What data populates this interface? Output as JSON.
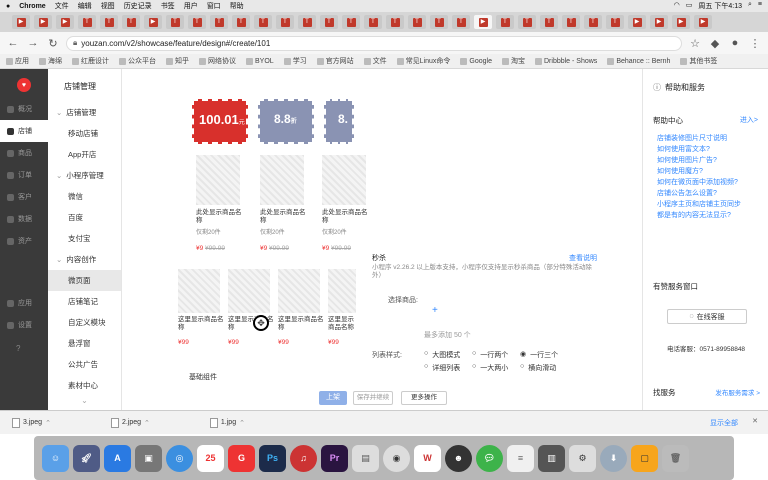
{
  "menubar": {
    "app": "Chrome",
    "items": [
      "文件",
      "编辑",
      "视图",
      "历史记录",
      "书签",
      "用户",
      "窗口",
      "帮助"
    ],
    "clock": "周五 下午4:13"
  },
  "browser": {
    "url": "youzan.com/v2/showcase/feature/design#/create/101",
    "bookmarks": [
      "应用",
      "海绵",
      "红鹿设计",
      "公众平台",
      "知乎",
      "网络协议",
      "BYOL",
      "学习",
      "官方网站",
      "文件",
      "常见Linux命令",
      "Google",
      "淘宝",
      "Dribbble - Shows",
      "Behance :: Bernh",
      "其他书签"
    ]
  },
  "leftnav": {
    "items": [
      "概况",
      "店铺",
      "商品",
      "订单",
      "客户",
      "数据",
      "资产",
      "应用",
      "设置"
    ]
  },
  "subnav": {
    "title": "店铺管理",
    "items": [
      "店铺管理",
      "移动店铺",
      "App开店",
      "小程序管理",
      "微信",
      "百度",
      "支付宝",
      "内容创作",
      "微页面",
      "店铺笔记",
      "自定义模块",
      "悬浮窗",
      "公共广告",
      "素材中心"
    ]
  },
  "coupons": {
    "big": "100.01",
    "unit": "元",
    "second": "8.8",
    "second_unit": "折",
    "third": "8."
  },
  "goods": {
    "row1": [
      {
        "name": "此处显示商品名称",
        "tag": "仅剩20件",
        "price": "¥9",
        "old": "¥99.99"
      },
      {
        "name": "此处显示商品名称",
        "tag": "仅剩20件",
        "price": "¥9",
        "old": "¥99.99"
      },
      {
        "name": "此处显示商品名称",
        "tag": "仅剩20件",
        "price": "¥9",
        "old": "¥99.99"
      }
    ],
    "row2": [
      {
        "name": "这里显示商品名称",
        "price": "¥99"
      },
      {
        "name": "这里显示商品名称",
        "price": "¥99"
      },
      {
        "name": "这里显示商品名称",
        "price": "¥99"
      },
      {
        "name": "这里显示商品名称",
        "price": "¥99"
      }
    ],
    "components_label": "基础组件"
  },
  "panel": {
    "title": "秒杀",
    "right_link": "查看说明",
    "desc": "小程序 v2.26.2 以上版本支持，小程序仅支持显示秒杀商品（部分特殊活动除外）",
    "choose_label": "选择商品:",
    "choose_hint": "最多添加 50 个",
    "list_style_label": "列表样式:",
    "styles": [
      "大图模式",
      "一行两个",
      "一行三个",
      "详细列表",
      "一大两小",
      "横向滑动"
    ]
  },
  "actions": {
    "publish": "上架",
    "save": "保存并继续",
    "more": "更多操作"
  },
  "rightpanel": {
    "title": "帮助和服务",
    "help_center": "帮助中心",
    "enter": "进入>",
    "links": [
      "店铺装修图片尺寸说明",
      "如何使用富文本?",
      "如何使用图片广告?",
      "如何使用魔方?",
      "如何在微页面中添加视频?",
      "店铺公告怎么设置?",
      "小程序主页和店铺主页同步",
      "都是有的内容无法显示?"
    ],
    "service_title": "有赞服务窗口",
    "online": "在线客服",
    "phone": "电话客服：0571-89958848",
    "find_service": "找服务",
    "post_demand": "发布服务需求 >"
  },
  "downloads": {
    "files": [
      "3.jpeg",
      "2.jpeg",
      "1.jpg"
    ],
    "show_all": "显示全部"
  },
  "dock": {
    "calendar_day": "25"
  }
}
